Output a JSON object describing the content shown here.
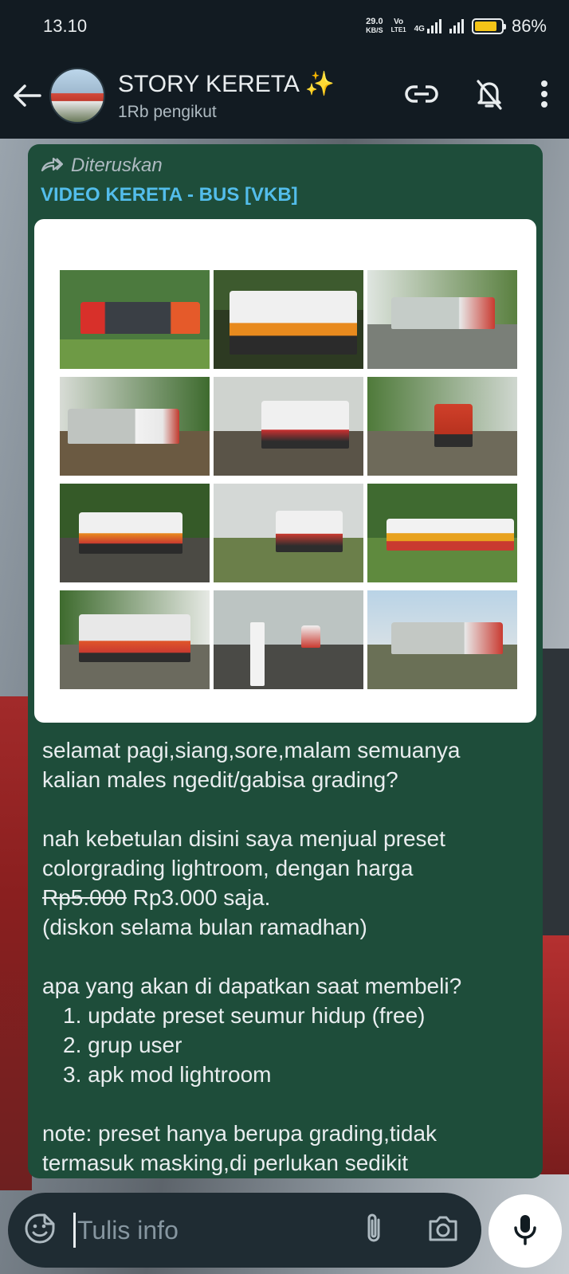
{
  "status_bar": {
    "time": "13.10",
    "speed_value": "29.0",
    "speed_unit": "KB/S",
    "volte": "Vo",
    "volte_sub": "LTE1",
    "network": "4G",
    "battery_percent": "86%",
    "battery_level": 0.86,
    "battery_color": "#f5c518"
  },
  "header": {
    "title": "STORY KERETA ✨",
    "subtitle": "1Rb pengikut",
    "icons": [
      "back-arrow-icon",
      "link-icon",
      "bell-off-icon",
      "more-vert-icon"
    ]
  },
  "message": {
    "forwarded_label": "Diteruskan",
    "source": "VIDEO KERETA - BUS [VKB]",
    "source_color": "#53bdeb",
    "bubble_color": "#1e4d3a",
    "lines": {
      "l1": "selamat pagi,siang,sore,malam semuanya",
      "l2": "kalian males ngedit/gabisa grading?",
      "l3": "nah kebetulan disini saya menjual preset",
      "l4": "colorgrading lightroom, dengan harga",
      "old_price": "Rp5.000",
      "new_price": " Rp3.000 saja.",
      "l6": "(diskon selama bulan ramadhan)",
      "l7": "apa yang akan di dapatkan saat membeli?",
      "l10": "note: preset hanya berupa grading,tidak",
      "l11": "termasuk masking,di perlukan sedikit"
    },
    "list_items": [
      "1. update preset seumur hidup (free)",
      "2. grup user",
      "3. apk mod lightroom"
    ]
  },
  "input": {
    "placeholder": "Tulis info",
    "icons": [
      "sticker-icon",
      "attach-icon",
      "camera-icon",
      "mic-icon"
    ]
  }
}
